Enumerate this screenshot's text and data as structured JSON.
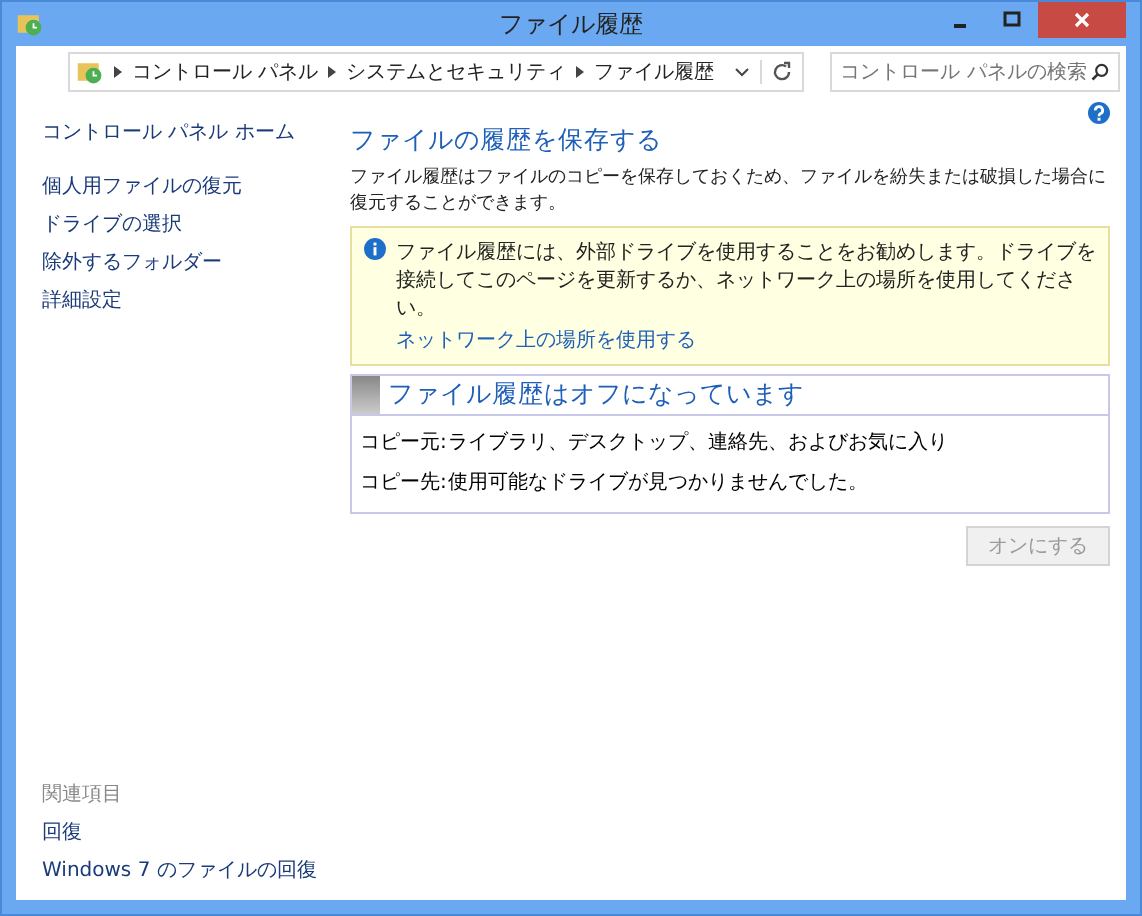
{
  "window": {
    "title": "ファイル履歴"
  },
  "address_bar": {
    "breadcrumbs": [
      "コントロール パネル",
      "システムとセキュリティ",
      "ファイル履歴"
    ]
  },
  "search": {
    "placeholder": "コントロール パネルの検索"
  },
  "sidebar": {
    "home_link": "コントロール パネル ホーム",
    "items": [
      "個人用ファイルの復元",
      "ドライブの選択",
      "除外するフォルダー",
      "詳細設定"
    ],
    "related_heading": "関連項目",
    "related_items": [
      "回復",
      "Windows 7 のファイルの回復"
    ]
  },
  "main": {
    "heading": "ファイルの履歴を保存する",
    "description": "ファイル履歴はファイルのコピーを保存しておくため、ファイルを紛失または破損した場合に復元することができます。",
    "notice": {
      "text": "ファイル履歴には、外部ドライブを使用することをお勧めします。ドライブを接続してこのページを更新するか、ネットワーク上の場所を使用してください。",
      "link": "ネットワーク上の場所を使用する"
    },
    "status_panel": {
      "title": "ファイル履歴はオフになっています",
      "rows": [
        {
          "label": "コピー元:",
          "value": "ライブラリ、デスクトップ、連絡先、およびお気に入り"
        },
        {
          "label": "コピー先:",
          "value": "使用可能なドライブが見つかりませんでした。"
        }
      ]
    },
    "button": {
      "label": "オンにする",
      "disabled": true
    }
  }
}
